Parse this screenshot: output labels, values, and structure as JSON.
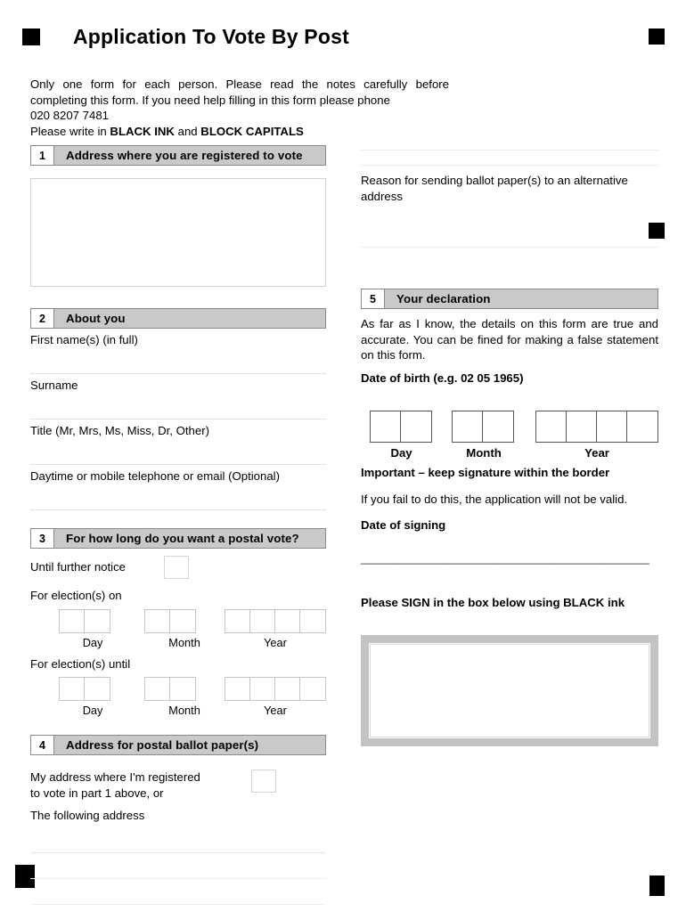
{
  "document": {
    "title": "Application To Vote By Post",
    "intro_line_1": "Only one form for each person. Please read the notes carefully before completing this form.  If you need help filling in this form please phone",
    "intro_phone": "020 8207 7481",
    "intro_instruction_prefix": "Please write in ",
    "intro_instruction_bold_1": "BLACK INK",
    "intro_instruction_middle": " and ",
    "intro_instruction_bold_2": "BLOCK CAPITALS"
  },
  "section1": {
    "number": "1",
    "title": "Address where you are registered to vote"
  },
  "section2": {
    "number": "2",
    "title": "About you",
    "fields": [
      {
        "label": "First name(s) (in full)"
      },
      {
        "label": "Surname"
      },
      {
        "label": "Title (Mr, Mrs, Ms, Miss, Dr, Other)"
      },
      {
        "label": "Daytime or mobile telephone or email (Optional)"
      }
    ]
  },
  "section3": {
    "number": "3",
    "title": "For how long do you want a postal vote?",
    "until_further_notice_label": "Until further notice",
    "elections_on_label": "For election(s) on",
    "elections_until_label": "For election(s) until",
    "date_captions": {
      "day": "Day",
      "month": "Month",
      "year": "Year"
    },
    "cell_counts": {
      "day": 2,
      "month": 2,
      "year": 4
    }
  },
  "section4": {
    "number": "4",
    "title": "Address for postal ballot paper(s)",
    "my_address_label_line_1": "My address where I'm registered",
    "my_address_label_line_2": "to vote in part 1 above, or",
    "following_address_label": "The following address"
  },
  "right_column": {
    "reason_label": "Reason for sending ballot paper(s) to an alternative address"
  },
  "section5": {
    "number": "5",
    "title": "Your declaration",
    "declaration_text": "As far as I know, the details on this form are true and accurate.  You can be fined for making a false statement on this form.",
    "date_of_birth_label": "Date of birth (e.g. 02 05 1965)",
    "date_captions": {
      "day": "Day",
      "month": "Month",
      "year": "Year"
    },
    "cell_counts": {
      "day": 2,
      "month": 2,
      "year": 4
    },
    "important_label": "Important – keep signature within the border",
    "important_note": "If you fail to do this, the application will not be valid.",
    "date_of_signing_label": "Date of signing",
    "date_of_signing_line": "______________________________________________",
    "sign_instruction": "Please SIGN in the box below using BLACK ink"
  },
  "colors": {
    "header_bar": "#c9c9c9",
    "header_border": "#8a8a8a",
    "field_rule": "#e7e7e7",
    "box_border": "#d2d2d2",
    "strong_cell_border": "#555555",
    "signature_border": "#c3c3c3",
    "marker": "#000000"
  }
}
